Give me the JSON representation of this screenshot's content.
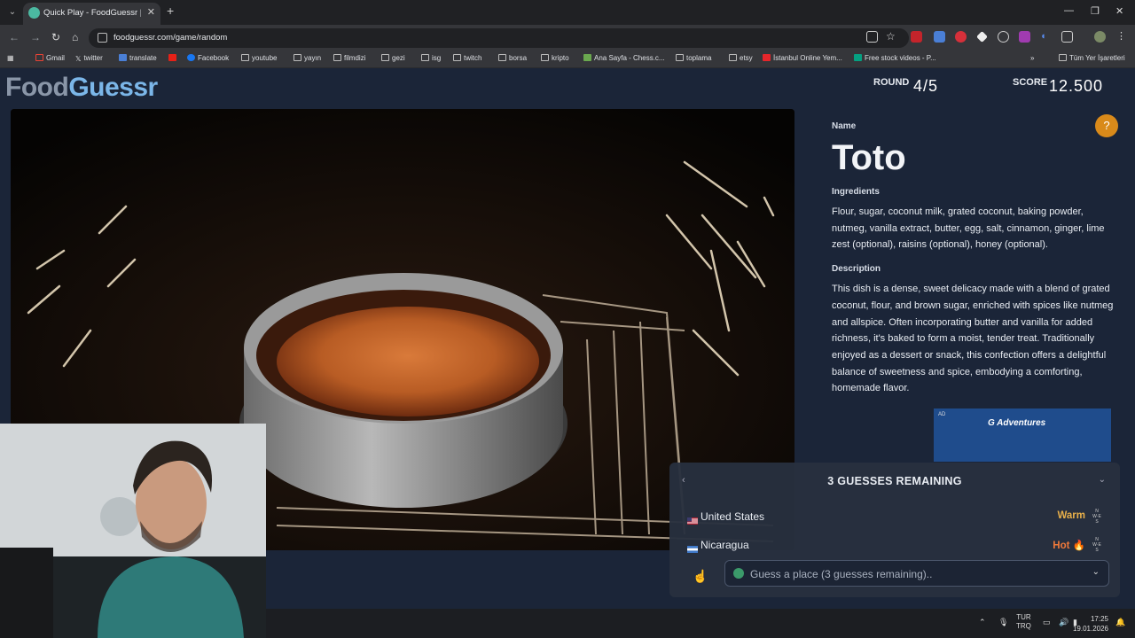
{
  "browser": {
    "tab_title": "Quick Play - FoodGuessr | Food",
    "url": "foodguessr.com/game/random",
    "bookmarks": [
      "Gmail",
      "twitter",
      "translate",
      "Facebook",
      "youtube",
      "yayın",
      "filmdizi",
      "gezi",
      "isg",
      "twitch",
      "borsa",
      "kripto",
      "Ana Sayfa - Chess.c...",
      "toplama",
      "etsy",
      "İstanbul Online Yem...",
      "Free stock videos - P..."
    ],
    "all_bookmarks": "Tüm Yer İşaretleri"
  },
  "header": {
    "logo_food": "Food",
    "logo_guessr": "Guessr",
    "round_label": "ROUND",
    "round_value": "4/5",
    "score_label": "SCORE",
    "score_value": "12.500"
  },
  "dish": {
    "name_label": "Name",
    "name": "Toto",
    "ingredients_label": "Ingredients",
    "ingredients": "Flour, sugar, coconut milk, grated coconut, baking powder, nutmeg, vanilla extract, butter, egg, salt, cinnamon, ginger, lime zest (optional), raisins (optional), honey (optional).",
    "description_label": "Description",
    "description": "This dish is a dense, sweet delicacy made with a blend of grated coconut, flour, and brown sugar, enriched with spices like nutmeg and allspice. Often incorporating butter and vanilla for added richness, it's baked to form a moist, tender treat. Traditionally enjoyed as a dessert or snack, this confection offers a delightful balance of sweetness and spice, embodying a comforting, homemade flavor."
  },
  "ad": {
    "label": "AD",
    "brand": "G Adventures"
  },
  "guesses": {
    "title": "3 GUESSES REMAINING",
    "items": [
      {
        "country": "United States",
        "hint": "Warm",
        "hint_color": "#e8b04a"
      },
      {
        "country": "Nicaragua",
        "hint": "Hot",
        "hint_color": "#f0793a"
      }
    ],
    "input_placeholder": "Guess a place (3 guesses remaining).."
  },
  "taskbar": {
    "lang_top": "TUR",
    "lang_bottom": "TRQ",
    "time": "17:25",
    "date": "19.01.2026"
  },
  "colors": {
    "page_bg": "#1b2538",
    "accent_orange": "#d98a1a",
    "logo_blue": "#7bb6e8"
  }
}
